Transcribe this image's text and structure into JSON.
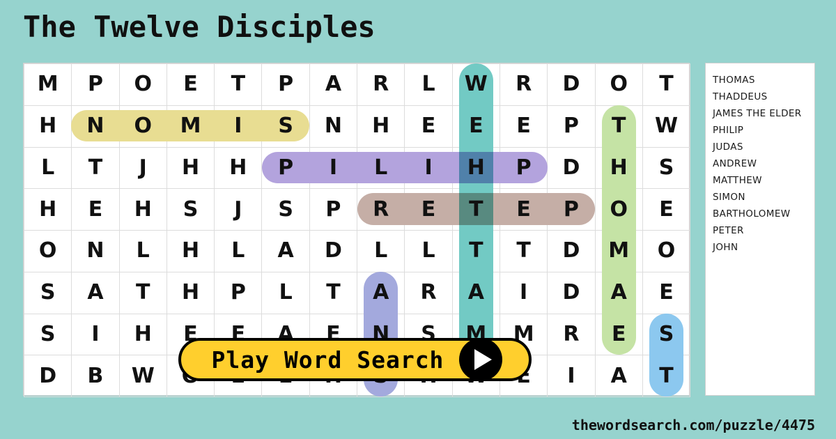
{
  "page": {
    "title": "The Twelve Disciples",
    "background_color": "#96d3ce",
    "footer_url": "thewordsearch.com/puzzle/4475"
  },
  "grid": {
    "rows": 8,
    "cols": 14,
    "letters": [
      [
        "M",
        "P",
        "O",
        "E",
        "T",
        "P",
        "A",
        "R",
        "L",
        "W",
        "R",
        "D",
        "O",
        "T"
      ],
      [
        "H",
        "N",
        "O",
        "M",
        "I",
        "S",
        "N",
        "H",
        "E",
        "E",
        "E",
        "P",
        "T",
        "W"
      ],
      [
        "L",
        "T",
        "J",
        "H",
        "H",
        "P",
        "I",
        "L",
        "I",
        "H",
        "P",
        "D",
        "H",
        "S"
      ],
      [
        "H",
        "E",
        "H",
        "S",
        "J",
        "S",
        "P",
        "R",
        "E",
        "T",
        "E",
        "P",
        "O",
        "E"
      ],
      [
        "O",
        "N",
        "L",
        "H",
        "L",
        "A",
        "D",
        "L",
        "L",
        "T",
        "T",
        "D",
        "M",
        "O"
      ],
      [
        "S",
        "A",
        "T",
        "H",
        "P",
        "L",
        "T",
        "A",
        "R",
        "A",
        "I",
        "D",
        "A",
        "E"
      ],
      [
        "S",
        "I",
        "H",
        "E",
        "E",
        "A",
        "E",
        "N",
        "S",
        "M",
        "M",
        "R",
        "E",
        "S"
      ],
      [
        "D",
        "B",
        "W",
        "O",
        "E",
        "E",
        "H",
        "S",
        "H",
        "W",
        "E",
        "I",
        "A",
        "T"
      ],
      [
        "",
        "",
        "",
        "",
        "",
        "",
        "",
        "",
        "",
        "",
        "",
        "",
        "",
        ""
      ]
    ],
    "last_row_letters": [
      "D",
      "B",
      "W",
      "O",
      "E",
      "E",
      "H",
      "S",
      "H",
      "W",
      "E",
      "I",
      "A",
      "T"
    ],
    "row8": [
      "D",
      "B",
      "W",
      "O",
      "E",
      "E",
      "H",
      "S",
      "H",
      "W",
      "E",
      "I",
      "A",
      "T"
    ],
    "highlights": [
      {
        "word": "SIMON",
        "color": "#e8dd92",
        "orientation": "horizontal",
        "row": 2,
        "col_start": 2,
        "col_end": 6
      },
      {
        "word": "PHILIP",
        "color": "#b3a3dd",
        "orientation": "horizontal",
        "row": 3,
        "col_start": 6,
        "col_end": 11
      },
      {
        "word": "PETER",
        "color": "#c5aea6",
        "orientation": "horizontal",
        "row": 4,
        "col_start": 8,
        "col_end": 12
      },
      {
        "word": "MATTHEW",
        "color": "#72cac4",
        "orientation": "vertical",
        "col": 10,
        "row_start": 1,
        "row_end": 7
      },
      {
        "word": "THOMAS",
        "color": "#c5e3a5",
        "orientation": "vertical",
        "col": 13,
        "row_start": 2,
        "row_end": 7
      },
      {
        "word": "ANDREW",
        "color": "#a3a9dd",
        "orientation": "vertical",
        "col": 8,
        "row_start": 6,
        "row_end": 8
      },
      {
        "word": "JAMES",
        "color": "#8cc8ef",
        "orientation": "vertical",
        "col": 14,
        "row_start": 7,
        "row_end": 8
      }
    ]
  },
  "word_list": [
    "THOMAS",
    "THADDEUS",
    "JAMES THE ELDER",
    "PHILIP",
    "JUDAS",
    "ANDREW",
    "MATTHEW",
    "SIMON",
    "BARTHOLOMEW",
    "PETER",
    "JOHN"
  ],
  "play_button": {
    "label": "Play Word Search",
    "background_color": "#ffcf2d",
    "icon": "play-triangle-icon"
  }
}
